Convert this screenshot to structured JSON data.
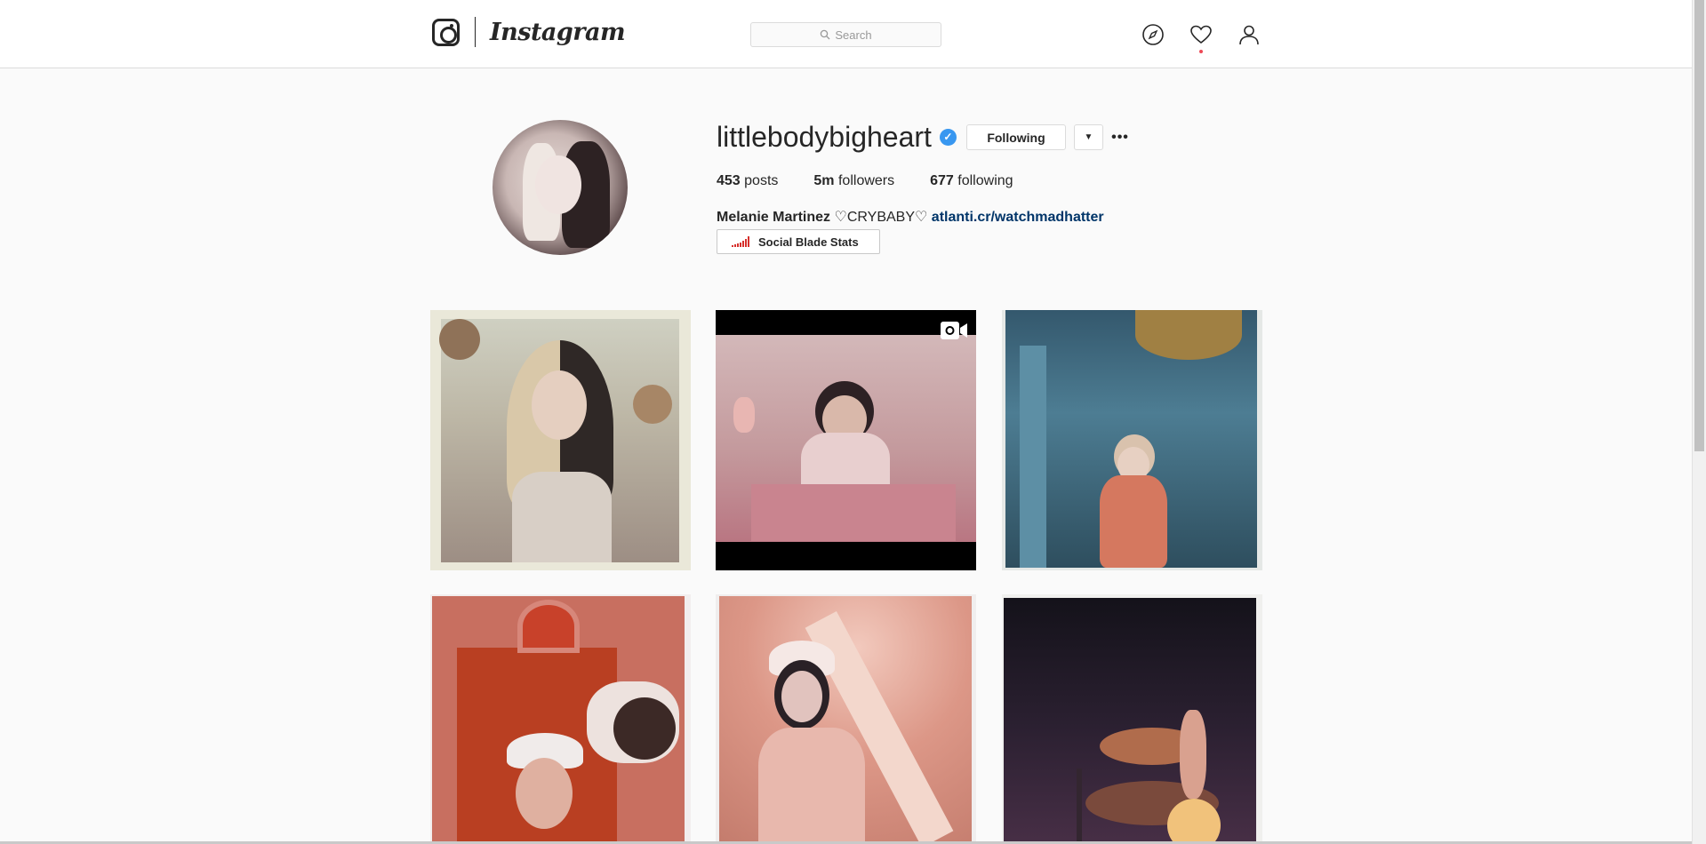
{
  "header": {
    "logo_text": "Instagram",
    "search_placeholder": "Search",
    "icons": [
      "compass-icon",
      "heart-icon",
      "profile-icon"
    ],
    "notification_dot_color": "#ed4956"
  },
  "profile": {
    "username": "littlebodybigheart",
    "verified": true,
    "following_button": "Following",
    "dropdown_glyph": "▼",
    "more_glyph": "•••",
    "stats": {
      "posts_count": "453",
      "posts_label": "posts",
      "followers_count": "5m",
      "followers_label": "followers",
      "following_count": "677",
      "following_label": "following"
    },
    "bio": {
      "name": "Melanie Martinez",
      "text": " ♡CRYBABY♡ ",
      "link": "atlanti.cr/watchmadhatter"
    },
    "social_blade_label": "Social Blade Stats"
  },
  "posts": [
    {
      "type": "photo",
      "palette": "#eae8d9"
    },
    {
      "type": "video",
      "palette": "#000000"
    },
    {
      "type": "photo",
      "palette": "#3f6d80"
    },
    {
      "type": "photo",
      "palette": "#b6432a"
    },
    {
      "type": "photo",
      "palette": "#d7a394"
    },
    {
      "type": "photo",
      "palette": "#1e1a22"
    }
  ],
  "colors": {
    "accent_link": "#003569",
    "verified_blue": "#3897f0",
    "social_blade_red": "#d6302c"
  }
}
